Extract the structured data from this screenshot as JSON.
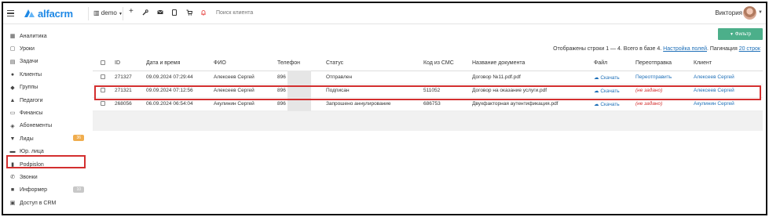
{
  "topbar": {
    "logo_text": "alfacrm",
    "branch": "demo",
    "search_placeholder": "Поиск клиента",
    "user_name": "Виктория"
  },
  "sidebar": {
    "items": [
      {
        "label": "Аналитика",
        "icon": "chart-icon"
      },
      {
        "label": "Уроки",
        "icon": "calendar-icon"
      },
      {
        "label": "Задачи",
        "icon": "tasks-icon"
      },
      {
        "label": "Клиенты",
        "icon": "user-icon"
      },
      {
        "label": "Группы",
        "icon": "users-icon"
      },
      {
        "label": "Педагоги",
        "icon": "graduation-cap-icon"
      },
      {
        "label": "Финансы",
        "icon": "money-icon"
      },
      {
        "label": "Абонементы",
        "icon": "tag-icon"
      },
      {
        "label": "Лиды",
        "icon": "funnel-icon",
        "badge": "36",
        "badge_color": "#f0ad4e"
      },
      {
        "label": "Юр. лица",
        "icon": "briefcase-icon"
      },
      {
        "label": "Podpislon",
        "icon": "document-icon"
      },
      {
        "label": "Звонки",
        "icon": "phone-icon"
      },
      {
        "label": "Информер",
        "icon": "informer-icon",
        "badge": "10",
        "badge_color": "#c8c8c8"
      },
      {
        "label": "Доступ в CRM",
        "icon": "lock-icon"
      }
    ]
  },
  "main": {
    "filter_button": "Фильтр",
    "info_text": "Отображены строки 1 — 4. Всего в базе 4.",
    "fields_link": "Настройка полей",
    "pagination_label": ". Пагинация",
    "pagination_link": "20 строк",
    "columns": [
      "ID",
      "Дата и время",
      "ФИО",
      "Телефон",
      "Статус",
      "Код из СМС",
      "Название документа",
      "Файл",
      "Переотправка",
      "Клиент"
    ],
    "rows": [
      {
        "id": "271327",
        "datetime": "09.09.2024 07:29:44",
        "name": "Алексеев Сергей",
        "phone": "896",
        "status": "Отправлен",
        "sms_code": "",
        "document": "Договор №11.pdf.pdf",
        "file": "Скачать",
        "resend": "Переотправить",
        "resend_type": "link",
        "client": "Алексеев Сергей"
      },
      {
        "id": "271321",
        "datetime": "09.09.2024 07:12:56",
        "name": "Алексеев Сергей",
        "phone": "896",
        "status": "Подписан",
        "sms_code": "511052",
        "document": "Договор на оказание услуги.pdf",
        "file": "Скачать",
        "resend": "(не задано)",
        "resend_type": "empty",
        "client": "Алексеев Сергей"
      },
      {
        "id": "268056",
        "datetime": "06.09.2024 06:54:04",
        "name": "Акулинин Сергей",
        "phone": "896",
        "status": "Запрошено аннулирование",
        "sms_code": "686753",
        "document": "Двухфакторная аутентификация.pdf",
        "file": "Скачать",
        "resend": "(не задано)",
        "resend_type": "empty",
        "client": "Акулинин Сергей"
      }
    ]
  },
  "colors": {
    "accent": "#1e88e5",
    "link": "#1e6fb8",
    "filter_button": "#4caf8a",
    "highlight": "#d32f2f"
  }
}
